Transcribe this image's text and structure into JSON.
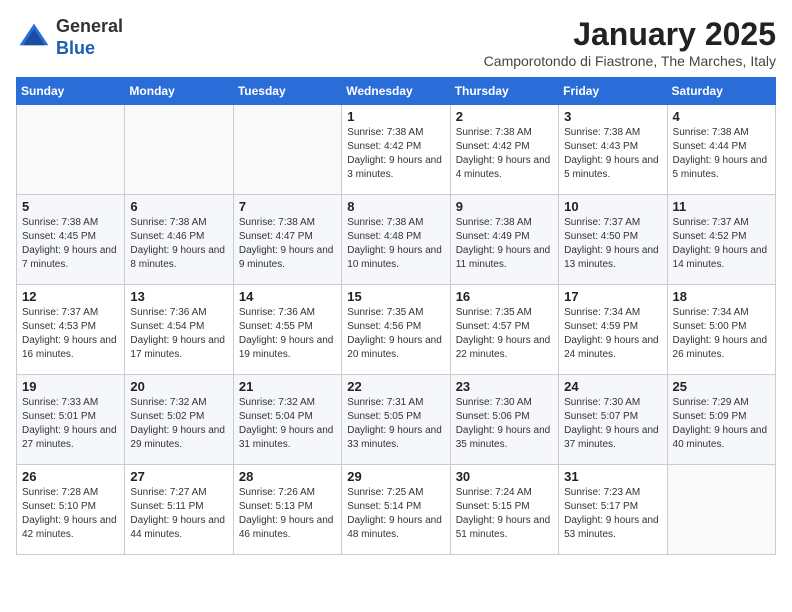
{
  "logo": {
    "general": "General",
    "blue": "Blue"
  },
  "header": {
    "month_title": "January 2025",
    "subtitle": "Camporotondo di Fiastrone, The Marches, Italy"
  },
  "weekdays": [
    "Sunday",
    "Monday",
    "Tuesday",
    "Wednesday",
    "Thursday",
    "Friday",
    "Saturday"
  ],
  "weeks": [
    [
      {
        "day": "",
        "info": ""
      },
      {
        "day": "",
        "info": ""
      },
      {
        "day": "",
        "info": ""
      },
      {
        "day": "1",
        "info": "Sunrise: 7:38 AM\nSunset: 4:42 PM\nDaylight: 9 hours and 3 minutes."
      },
      {
        "day": "2",
        "info": "Sunrise: 7:38 AM\nSunset: 4:42 PM\nDaylight: 9 hours and 4 minutes."
      },
      {
        "day": "3",
        "info": "Sunrise: 7:38 AM\nSunset: 4:43 PM\nDaylight: 9 hours and 5 minutes."
      },
      {
        "day": "4",
        "info": "Sunrise: 7:38 AM\nSunset: 4:44 PM\nDaylight: 9 hours and 5 minutes."
      }
    ],
    [
      {
        "day": "5",
        "info": "Sunrise: 7:38 AM\nSunset: 4:45 PM\nDaylight: 9 hours and 7 minutes."
      },
      {
        "day": "6",
        "info": "Sunrise: 7:38 AM\nSunset: 4:46 PM\nDaylight: 9 hours and 8 minutes."
      },
      {
        "day": "7",
        "info": "Sunrise: 7:38 AM\nSunset: 4:47 PM\nDaylight: 9 hours and 9 minutes."
      },
      {
        "day": "8",
        "info": "Sunrise: 7:38 AM\nSunset: 4:48 PM\nDaylight: 9 hours and 10 minutes."
      },
      {
        "day": "9",
        "info": "Sunrise: 7:38 AM\nSunset: 4:49 PM\nDaylight: 9 hours and 11 minutes."
      },
      {
        "day": "10",
        "info": "Sunrise: 7:37 AM\nSunset: 4:50 PM\nDaylight: 9 hours and 13 minutes."
      },
      {
        "day": "11",
        "info": "Sunrise: 7:37 AM\nSunset: 4:52 PM\nDaylight: 9 hours and 14 minutes."
      }
    ],
    [
      {
        "day": "12",
        "info": "Sunrise: 7:37 AM\nSunset: 4:53 PM\nDaylight: 9 hours and 16 minutes."
      },
      {
        "day": "13",
        "info": "Sunrise: 7:36 AM\nSunset: 4:54 PM\nDaylight: 9 hours and 17 minutes."
      },
      {
        "day": "14",
        "info": "Sunrise: 7:36 AM\nSunset: 4:55 PM\nDaylight: 9 hours and 19 minutes."
      },
      {
        "day": "15",
        "info": "Sunrise: 7:35 AM\nSunset: 4:56 PM\nDaylight: 9 hours and 20 minutes."
      },
      {
        "day": "16",
        "info": "Sunrise: 7:35 AM\nSunset: 4:57 PM\nDaylight: 9 hours and 22 minutes."
      },
      {
        "day": "17",
        "info": "Sunrise: 7:34 AM\nSunset: 4:59 PM\nDaylight: 9 hours and 24 minutes."
      },
      {
        "day": "18",
        "info": "Sunrise: 7:34 AM\nSunset: 5:00 PM\nDaylight: 9 hours and 26 minutes."
      }
    ],
    [
      {
        "day": "19",
        "info": "Sunrise: 7:33 AM\nSunset: 5:01 PM\nDaylight: 9 hours and 27 minutes."
      },
      {
        "day": "20",
        "info": "Sunrise: 7:32 AM\nSunset: 5:02 PM\nDaylight: 9 hours and 29 minutes."
      },
      {
        "day": "21",
        "info": "Sunrise: 7:32 AM\nSunset: 5:04 PM\nDaylight: 9 hours and 31 minutes."
      },
      {
        "day": "22",
        "info": "Sunrise: 7:31 AM\nSunset: 5:05 PM\nDaylight: 9 hours and 33 minutes."
      },
      {
        "day": "23",
        "info": "Sunrise: 7:30 AM\nSunset: 5:06 PM\nDaylight: 9 hours and 35 minutes."
      },
      {
        "day": "24",
        "info": "Sunrise: 7:30 AM\nSunset: 5:07 PM\nDaylight: 9 hours and 37 minutes."
      },
      {
        "day": "25",
        "info": "Sunrise: 7:29 AM\nSunset: 5:09 PM\nDaylight: 9 hours and 40 minutes."
      }
    ],
    [
      {
        "day": "26",
        "info": "Sunrise: 7:28 AM\nSunset: 5:10 PM\nDaylight: 9 hours and 42 minutes."
      },
      {
        "day": "27",
        "info": "Sunrise: 7:27 AM\nSunset: 5:11 PM\nDaylight: 9 hours and 44 minutes."
      },
      {
        "day": "28",
        "info": "Sunrise: 7:26 AM\nSunset: 5:13 PM\nDaylight: 9 hours and 46 minutes."
      },
      {
        "day": "29",
        "info": "Sunrise: 7:25 AM\nSunset: 5:14 PM\nDaylight: 9 hours and 48 minutes."
      },
      {
        "day": "30",
        "info": "Sunrise: 7:24 AM\nSunset: 5:15 PM\nDaylight: 9 hours and 51 minutes."
      },
      {
        "day": "31",
        "info": "Sunrise: 7:23 AM\nSunset: 5:17 PM\nDaylight: 9 hours and 53 minutes."
      },
      {
        "day": "",
        "info": ""
      }
    ]
  ]
}
